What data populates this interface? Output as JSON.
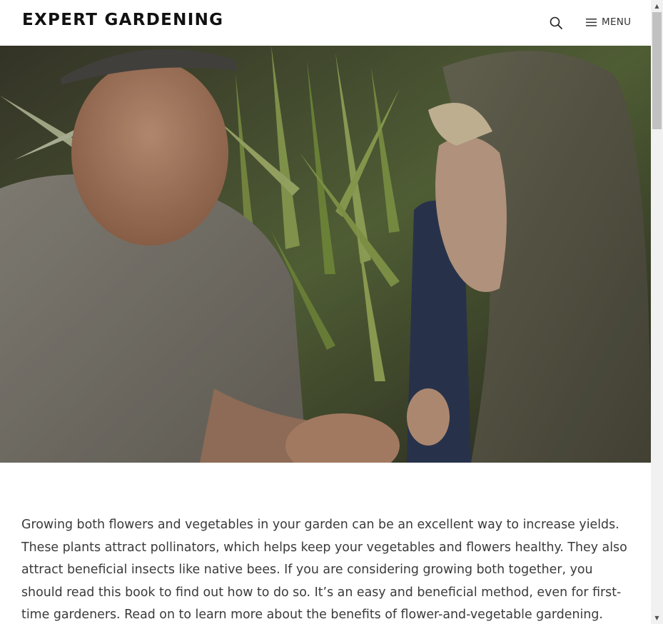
{
  "header": {
    "site_title": "EXPERT GARDENING",
    "search_icon": "search-icon",
    "menu_icon": "hamburger-menu-icon",
    "menu_label": "MENU"
  },
  "hero": {
    "image_alt": "Man and child looking at soil and a worm in a garden"
  },
  "article": {
    "paragraph": "Growing both flowers and vegetables in your garden can be an excellent way to increase yields. These plants attract pollinators, which helps keep your vegetables and flowers healthy. They also attract beneficial insects like native bees. If you are considering growing both together, you should read this book to find out how to do so. It’s an easy and beneficial method, even for first-time gardeners. Read on to learn more about the benefits of flower-and-vegetable gardening."
  },
  "scrollbar": {
    "up_icon": "scroll-up-arrow-icon",
    "down_icon": "scroll-down-arrow-icon",
    "up_glyph": "▲",
    "down_glyph": "▼"
  },
  "colors": {
    "title": "#111111",
    "body_text": "#3a3a3a",
    "background": "#ffffff"
  }
}
